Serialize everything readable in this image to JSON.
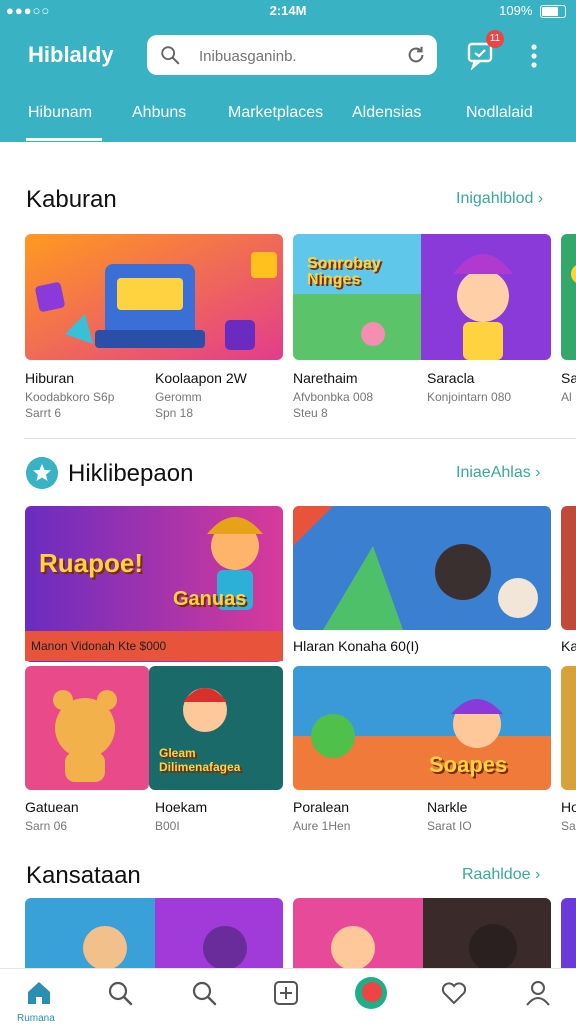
{
  "status_bar": {
    "time": "2:14M",
    "battery": "109%",
    "signal": "●●●○○"
  },
  "header": {
    "app_title": "Hiblaldy",
    "search_placeholder": "Inibuasganinb.",
    "notification_count": "11"
  },
  "tabs": [
    "Hibunam",
    "Ahbuns",
    "Marketplaces",
    "Aldensias",
    "Nodlalaid"
  ],
  "sections": [
    {
      "title": "Kaburan",
      "see_all": "Inigahlblod ›",
      "items": [
        {
          "name": "Hiburan",
          "line1": "Koodabkoro S6p",
          "line2": "Sarrt 6"
        },
        {
          "name": "Koolaapon 2W",
          "line1": "Geromm",
          "line2": "Spn 18"
        },
        {
          "name": "Narethaim",
          "line1": "Afvbonbka 008",
          "line2": "Steu 8"
        },
        {
          "name": "Saracla",
          "line1": "Konjointarn 080",
          "line2": ""
        },
        {
          "name": "Sa",
          "line1": "Al",
          "line2": ""
        }
      ]
    },
    {
      "title": "Hiklibepaon",
      "see_all": "IniaeAhlas ›",
      "banner_art": "Ruapoe!",
      "banner_sub": "Ganuas",
      "banner_strip": "Manon Vidonah Kte $000",
      "top_right_caption": "Hlaran Konaha 60(I)",
      "top_right_caption_clip": "Ka",
      "items": [
        {
          "name": "Gatuean",
          "line1": "Sarn 06"
        },
        {
          "name": "Hoekam",
          "line1": "B00I",
          "art": "Gleam Dilimenafagea"
        },
        {
          "name": "Poralean",
          "line1": "Aure 1Hen"
        },
        {
          "name": "Narkle",
          "line1": "Sarat IO",
          "art": "Soapes"
        },
        {
          "name": "Ho",
          "line1": "Sa"
        }
      ]
    },
    {
      "title": "Kansataan",
      "see_all": "Raahldoe ›"
    }
  ],
  "art_labels": {
    "thumb_b": "Sonrobay Ninges"
  },
  "bottom_nav": {
    "home_label": "Rumana"
  },
  "colors": {
    "primary": "#39b3c3",
    "accent": "#3aa89a",
    "alert": "#ef4444"
  }
}
